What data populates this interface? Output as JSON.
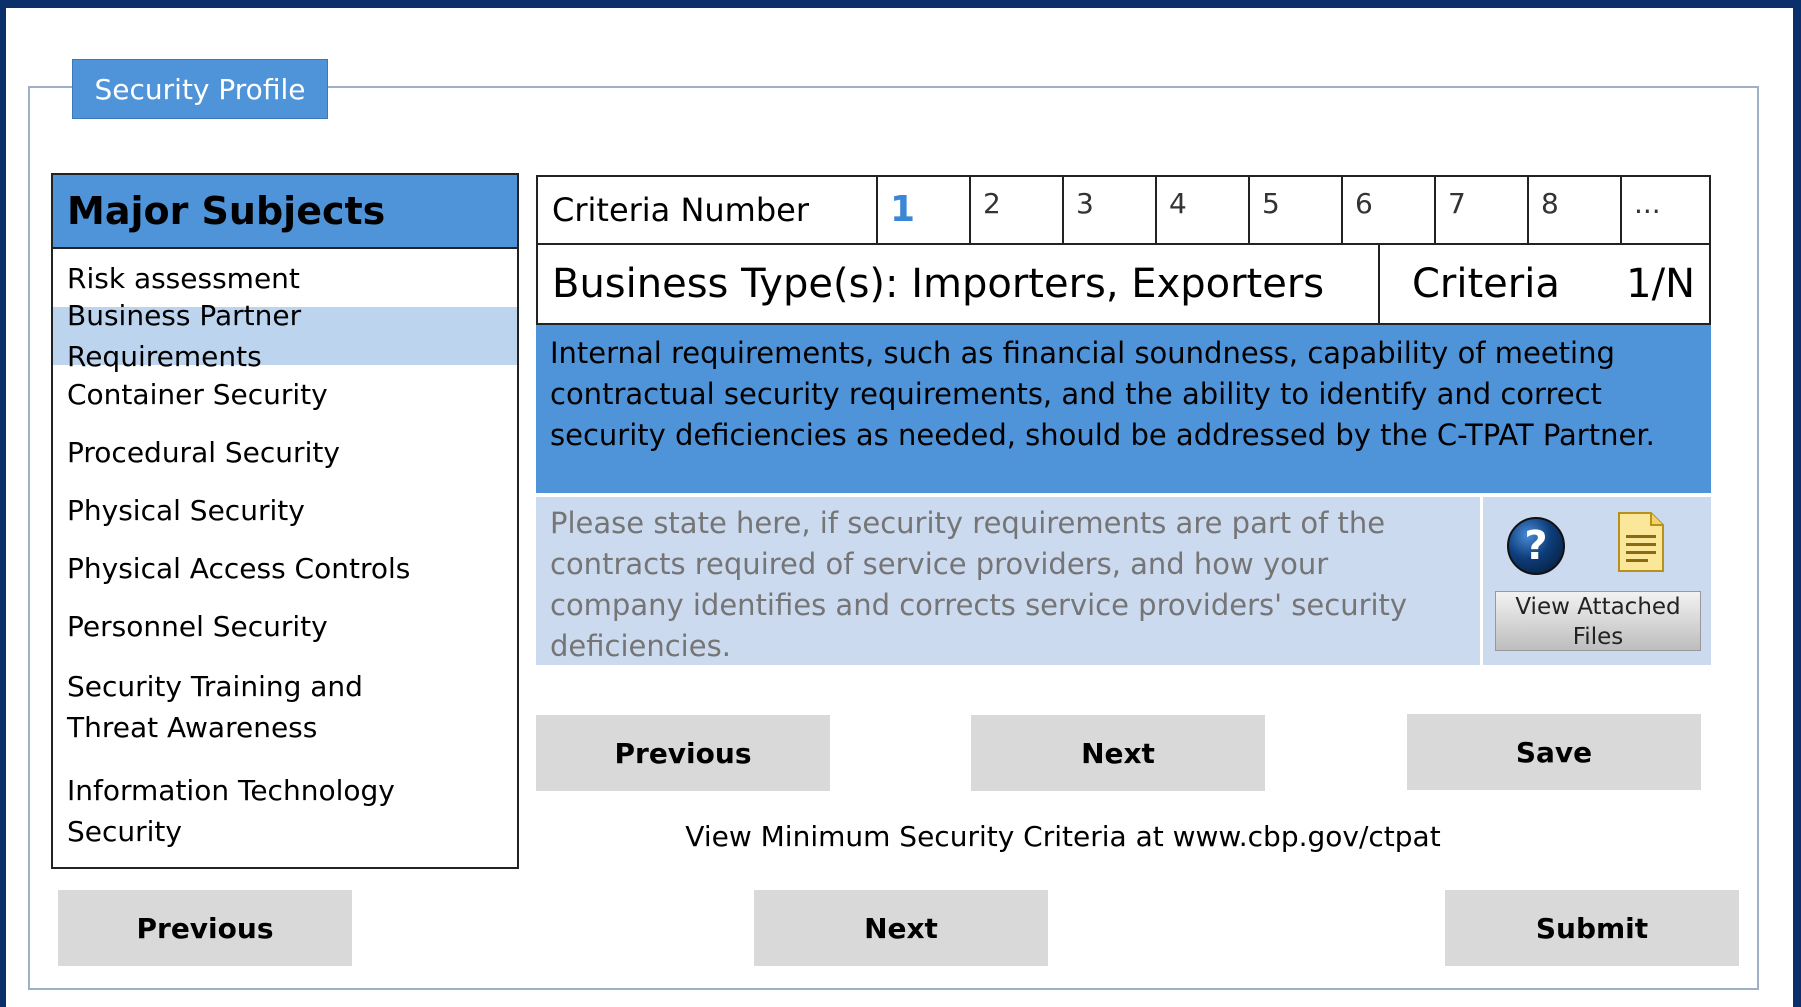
{
  "tab": {
    "title": "Security Profile"
  },
  "sidebar": {
    "header": "Major Subjects",
    "items": [
      {
        "label": "Risk assessment"
      },
      {
        "label": "Business Partner Requirements"
      },
      {
        "label": "Container Security"
      },
      {
        "label": "Procedural Security"
      },
      {
        "label": "Physical Security"
      },
      {
        "label": "Physical Access Controls"
      },
      {
        "label": "Personnel Security"
      },
      {
        "label": "Security Training and Threat Awareness"
      },
      {
        "label": "Information Technology Security"
      }
    ],
    "active_index": 1
  },
  "criteria": {
    "label": "Criteria Number",
    "numbers": [
      "1",
      "2",
      "3",
      "4",
      "5",
      "6",
      "7",
      "8",
      "..."
    ],
    "current": "1"
  },
  "business": {
    "types": "Business Type(s): Importers, Exporters",
    "criteria_label": "Criteria",
    "criteria_value": "1/N"
  },
  "description": "Internal requirements, such as financial soundness, capability of meeting contractual security requirements, and the ability to identify and correct security deficiencies as needed, should be addressed by the C-TPAT Partner.",
  "answer": {
    "placeholder": "Please state here, if security requirements are part of the contracts required of service providers, and how your company identifies and corrects service providers' security deficiencies.",
    "value": ""
  },
  "attachments": {
    "button_label": "View Attached Files"
  },
  "inner_nav": {
    "previous": "Previous",
    "next": "Next",
    "save": "Save"
  },
  "footer_note": "View Minimum Security Criteria at www.cbp.gov/ctpat",
  "bottom_nav": {
    "previous": "Previous",
    "next": "Next",
    "submit": "Submit"
  },
  "colors": {
    "accent": "#4f93d9",
    "active_row": "#bcd4ee",
    "answer_bg": "#ccdaf0",
    "frame": "#0b2f6b",
    "button": "#d9d9d9"
  },
  "icons": {
    "help": "question-icon",
    "document": "document-icon"
  }
}
